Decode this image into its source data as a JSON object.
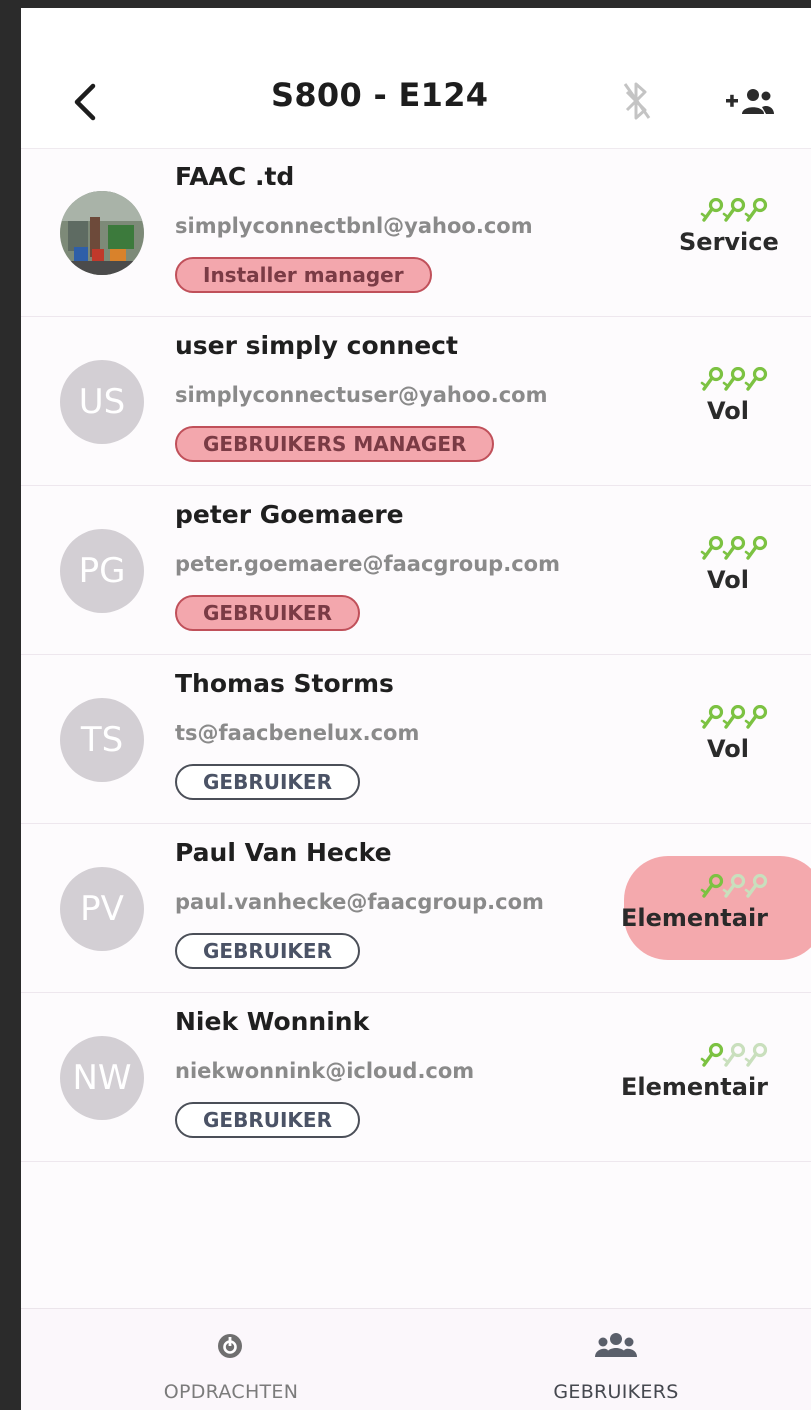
{
  "header": {
    "title": "S800 - E124"
  },
  "users": [
    {
      "name": "FAAC .td",
      "email": "simplyconnectbnl@yahoo.com",
      "role": "Installer manager",
      "role_highlight": true,
      "initials": "",
      "photo": true,
      "keys_active": 3,
      "level": "Service",
      "level_highlight": false
    },
    {
      "name": "user simply connect",
      "email": "simplyconnectuser@yahoo.com",
      "role": "GEBRUIKERS MANAGER",
      "role_highlight": true,
      "initials": "US",
      "photo": false,
      "keys_active": 3,
      "level": "Vol",
      "level_highlight": false
    },
    {
      "name": "peter Goemaere",
      "email": "peter.goemaere@faacgroup.com",
      "role": "GEBRUIKER",
      "role_highlight": true,
      "initials": "PG",
      "photo": false,
      "keys_active": 3,
      "level": "Vol",
      "level_highlight": false
    },
    {
      "name": "Thomas Storms",
      "email": "ts@faacbenelux.com",
      "role": "GEBRUIKER",
      "role_highlight": false,
      "initials": "TS",
      "photo": false,
      "keys_active": 3,
      "level": "Vol",
      "level_highlight": false
    },
    {
      "name": "Paul Van Hecke",
      "email": "paul.vanhecke@faacgroup.com",
      "role": "GEBRUIKER",
      "role_highlight": false,
      "initials": "PV",
      "photo": false,
      "keys_active": 1,
      "level": "Elementair",
      "level_highlight": true
    },
    {
      "name": "Niek Wonnink",
      "email": "niekwonnink@icloud.com",
      "role": "GEBRUIKER",
      "role_highlight": false,
      "initials": "NW",
      "photo": false,
      "keys_active": 1,
      "level": "Elementair",
      "level_highlight": false
    }
  ],
  "bottom_nav": [
    {
      "label": "OPDRACHTEN",
      "icon": "power-icon",
      "active": false
    },
    {
      "label": "GEBRUIKERS",
      "icon": "users-icon",
      "active": true
    }
  ],
  "colors": {
    "key_active": "#7cc242",
    "key_inactive": "#c9dfbd",
    "highlight": "#f3a7ad"
  }
}
